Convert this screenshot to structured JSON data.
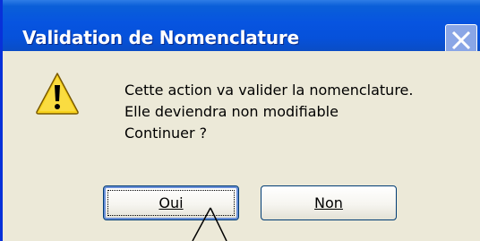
{
  "window": {
    "title": "Validation de Nomenclature"
  },
  "message": {
    "lines": [
      "Cette action va valider la nomenclature.",
      "Elle deviendra non modifiable",
      "Continuer ?"
    ]
  },
  "buttons": {
    "yes_label": "Oui",
    "no_label": "Non"
  },
  "icons": {
    "close": "close-icon",
    "warning": "warning-icon"
  },
  "colors": {
    "titlebar": "#0754e0",
    "dialog_background": "#ece9d8",
    "warning_fill": "#f8d21c"
  }
}
